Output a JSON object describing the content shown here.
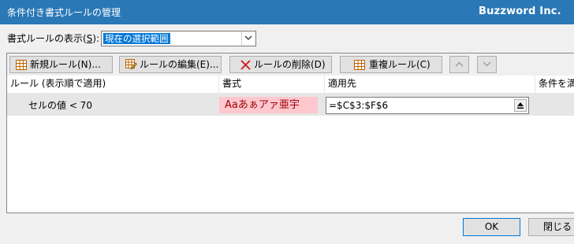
{
  "window": {
    "title": "条件付き書式ルールの管理",
    "brand": "Buzzword Inc."
  },
  "show_rules": {
    "label_prefix": "書式ルールの表示(",
    "label_key": "S",
    "label_suffix": "):",
    "selected": "現在の選択範囲"
  },
  "toolbar": {
    "new_rule": "新規ルール(N)...",
    "edit_rule": "ルールの編集(E)...",
    "delete_rule": "ルールの削除(D)",
    "duplicate_rule": "重複ルール(C)"
  },
  "table": {
    "headers": [
      "ルール (表示順で適用)",
      "書式",
      "適用先",
      "条件を満"
    ],
    "rows": [
      {
        "rule": "セルの値 < 70",
        "format_preview": "Aaあぁアァ亜宇",
        "applies_to": "=$C$3:$F$6"
      }
    ]
  },
  "footer": {
    "ok": "OK",
    "close": "閉じる"
  }
}
